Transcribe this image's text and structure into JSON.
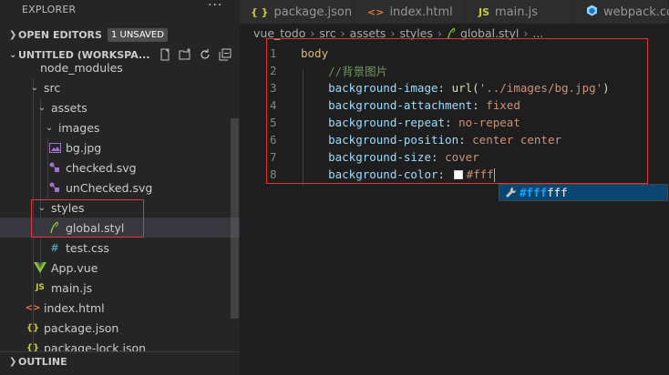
{
  "explorer": {
    "title": "EXPLORER",
    "more": "···",
    "open_editors": {
      "label": "OPEN EDITORS",
      "badge": "1 UNSAVED"
    },
    "workspace": {
      "label": "UNTITLED (WORKSPA..."
    },
    "tree": [
      {
        "label": "node_modules",
        "icon": "",
        "kind": "folder-collapsed"
      },
      {
        "label": "src",
        "icon": "",
        "kind": "folder-open"
      },
      {
        "label": "assets",
        "icon": "",
        "kind": "folder-open"
      },
      {
        "label": "images",
        "icon": "",
        "kind": "folder-open"
      },
      {
        "label": "bg.jpg",
        "icon": "image-icon",
        "kind": "file"
      },
      {
        "label": "checked.svg",
        "icon": "svg-icon",
        "kind": "file"
      },
      {
        "label": "unChecked.svg",
        "icon": "svg-icon",
        "kind": "file"
      },
      {
        "label": "styles",
        "icon": "",
        "kind": "folder-open"
      },
      {
        "label": "global.styl",
        "icon": "stylus-icon",
        "kind": "file"
      },
      {
        "label": "test.css",
        "icon": "css-icon",
        "kind": "file"
      },
      {
        "label": "App.vue",
        "icon": "vue-icon",
        "kind": "file"
      },
      {
        "label": "main.js",
        "icon": "js-icon",
        "kind": "file"
      },
      {
        "label": "index.html",
        "icon": "html-icon",
        "kind": "file"
      },
      {
        "label": "package.json",
        "icon": "json-icon",
        "kind": "file"
      },
      {
        "label": "package-lock.json",
        "icon": "json-icon",
        "kind": "file"
      }
    ],
    "outline": {
      "label": "OUTLINE"
    }
  },
  "tabs": [
    {
      "label": "package.json",
      "icon_glyph": "{ }"
    },
    {
      "label": "index.html",
      "icon_glyph": "<>"
    },
    {
      "label": "main.js",
      "icon_glyph": "JS"
    },
    {
      "label": "webpack.co",
      "icon_glyph": ""
    }
  ],
  "breadcrumb": [
    "vue_todo",
    "src",
    "assets",
    "styles",
    "global.styl",
    "..."
  ],
  "editor": {
    "lines": [
      {
        "n": "1",
        "parts": [
          [
            "kw",
            "body"
          ]
        ]
      },
      {
        "n": "2",
        "parts": [
          [
            "cm",
            "    //背景图片"
          ]
        ]
      },
      {
        "n": "3",
        "parts": [
          [
            "prop",
            "    background-image"
          ],
          [
            "punct",
            ": "
          ],
          [
            "fn",
            "url"
          ],
          [
            "punct",
            "("
          ],
          [
            "val",
            "'../images/bg.jpg'"
          ],
          [
            "punct",
            ")"
          ]
        ]
      },
      {
        "n": "4",
        "parts": [
          [
            "prop",
            "    background-attachment"
          ],
          [
            "punct",
            ": "
          ],
          [
            "val",
            "fixed"
          ]
        ]
      },
      {
        "n": "5",
        "parts": [
          [
            "prop",
            "    background-repeat"
          ],
          [
            "punct",
            ": "
          ],
          [
            "val",
            "no-repeat"
          ]
        ]
      },
      {
        "n": "6",
        "parts": [
          [
            "prop",
            "    background-position"
          ],
          [
            "punct",
            ": "
          ],
          [
            "val",
            "center center"
          ]
        ]
      },
      {
        "n": "7",
        "parts": [
          [
            "prop",
            "    background-size"
          ],
          [
            "punct",
            ": "
          ],
          [
            "val",
            "cover"
          ]
        ]
      },
      {
        "n": "8",
        "parts": [
          [
            "prop",
            "    background-color"
          ],
          [
            "punct",
            ": "
          ],
          [
            "swatch",
            ""
          ],
          [
            "val",
            "#fff"
          ]
        ]
      }
    ]
  },
  "suggestion": {
    "match": "#fff",
    "rest": "fff"
  },
  "colors": {
    "accent": "#094771",
    "highlight": "#18a3ff",
    "annotation_red": "#e0363d",
    "swatch": "#ffffff"
  }
}
